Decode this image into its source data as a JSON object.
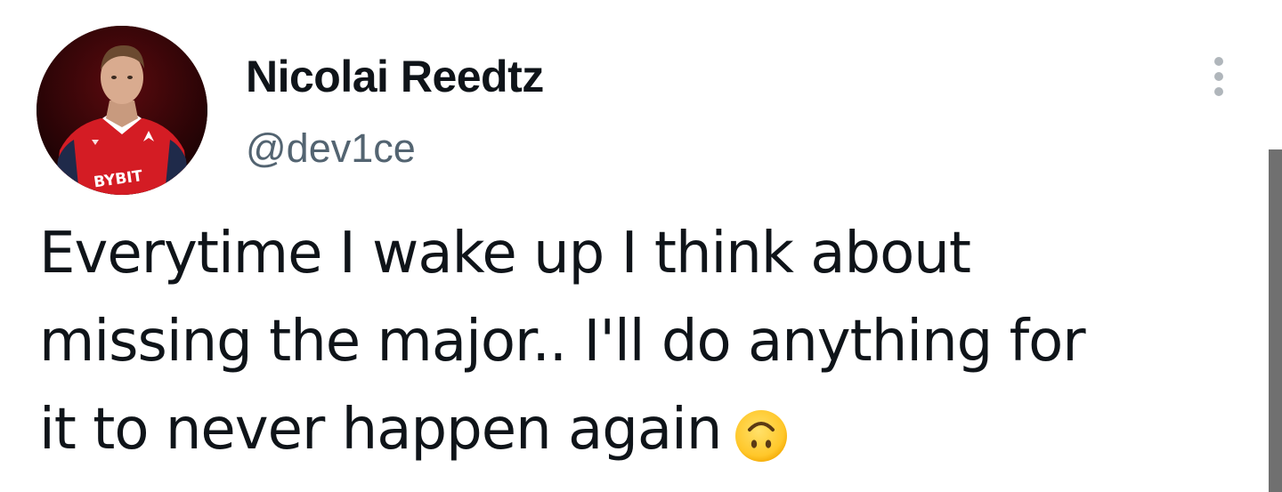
{
  "tweet": {
    "author": {
      "display_name": "Nicolai Reedtz",
      "username": "@dev1ce",
      "avatar_jersey_text": "BYBIT"
    },
    "text_lines": [
      "Everytime I wake up I think about",
      "missing the major.. I'll do anything for",
      "it to never happen again"
    ],
    "emoji": "upside-down-face-emoji",
    "more_icon": "more-vertical-icon"
  },
  "colors": {
    "text_primary": "#0f1419",
    "text_secondary": "#536471",
    "jersey_red": "#d41c24",
    "scrollbar": "#707070"
  }
}
